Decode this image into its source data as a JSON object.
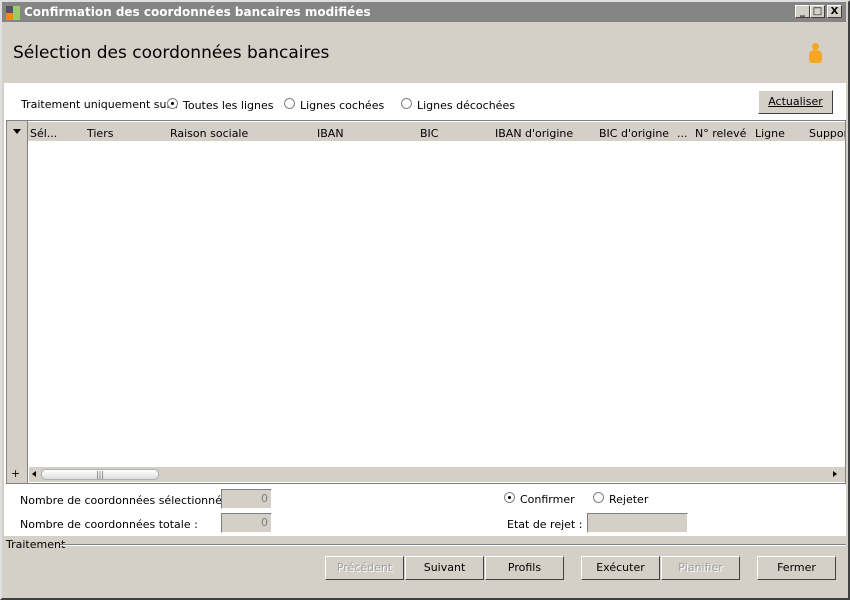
{
  "window": {
    "title": "Confirmation des coordonnées bancaires modifiées",
    "minimize": "_",
    "maximize": "□",
    "close": "X"
  },
  "header": {
    "title": "Sélection des coordonnées bancaires",
    "icon": "user-icon"
  },
  "filter": {
    "label": "Traitement uniquement sur :",
    "options": [
      {
        "label": "Toutes les lignes",
        "selected": true
      },
      {
        "label": "Lignes cochées",
        "selected": false
      },
      {
        "label": "Lignes décochées",
        "selected": false
      }
    ],
    "refresh": "Actualiser"
  },
  "grid": {
    "columns": [
      "Sél...",
      "Tiers",
      "Raison sociale",
      "IBAN",
      "BIC",
      "IBAN d'origine",
      "BIC d'origine",
      "...",
      "N° relevé",
      "Ligne",
      "Suppor"
    ],
    "rows": [],
    "expand": "+"
  },
  "summary": {
    "selected_label": "Nombre de coordonnées sélectionnées :",
    "selected_value": "0",
    "total_label": "Nombre de coordonnées totale :",
    "total_value": "0"
  },
  "decision": {
    "confirm": "Confirmer",
    "reject": "Rejeter",
    "selected": "Confirmer",
    "reject_state_label": "Etat de rejet :",
    "reject_state_value": ""
  },
  "footer": {
    "group": "Traitement",
    "buttons": {
      "previous": "Précédent",
      "next": "Suivant",
      "profiles": "Profils",
      "execute": "Exécuter",
      "schedule": "Planifier",
      "close": "Fermer"
    }
  }
}
